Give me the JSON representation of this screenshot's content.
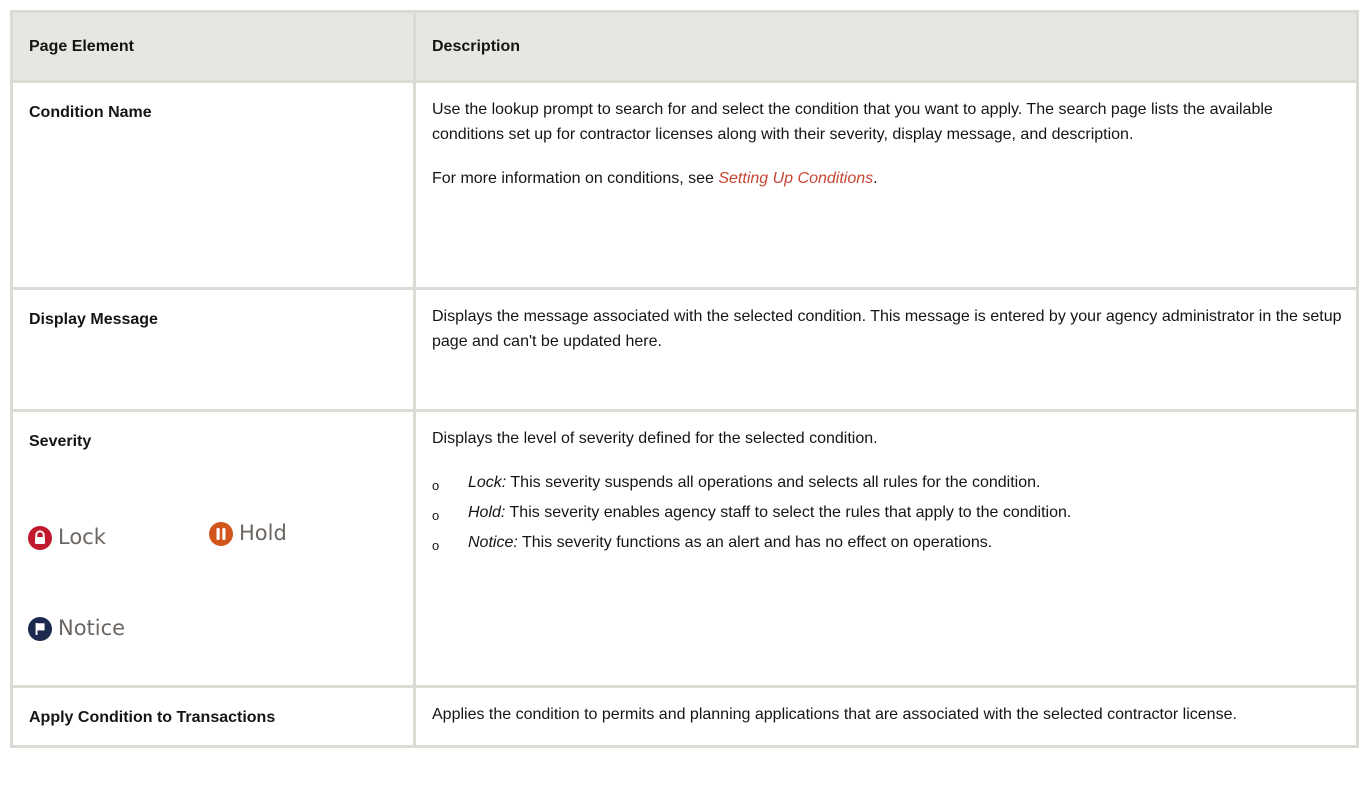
{
  "table": {
    "headers": [
      "Page Element",
      "Description"
    ],
    "rows": [
      {
        "element": "Condition Name",
        "description": [
          "Use the lookup prompt to search for and select the condition that you want to apply. The search page lists the available conditions set up for contractor licenses along with their severity, display message, and description."
        ],
        "more_info_prefix": "For more information on conditions, see ",
        "more_info_link": "Setting Up Conditions",
        "more_info_suffix": "."
      },
      {
        "element": "Display Message",
        "description": [
          "Displays the message associated with the selected condition. This message is entered by your agency administrator in the setup page and can't be updated here."
        ]
      },
      {
        "element": "Severity",
        "description": [
          "Displays the level of severity defined for the selected condition."
        ],
        "severity_icons": [
          {
            "label": "Lock",
            "icon": "lock-icon",
            "color": "#c0182d"
          },
          {
            "label": "Hold",
            "icon": "pause-icon",
            "color": "#d2561b"
          },
          {
            "label": "Notice",
            "icon": "flag-icon",
            "color": "#1b2a4e"
          }
        ],
        "levels": [
          {
            "term": "Lock:",
            "text": " This severity suspends all operations and selects all rules for the condition."
          },
          {
            "term": "Hold:",
            "text": " This severity enables agency staff to select the rules that apply to the condition."
          },
          {
            "term": "Notice:",
            "text": " This severity functions as an alert and has no effect on operations."
          }
        ],
        "bullet": "o"
      },
      {
        "element": "Apply Condition to Transactions",
        "description": [
          "Applies the condition to permits and planning applications that are associated with the selected contractor license."
        ]
      }
    ]
  },
  "colors": {
    "header_bg": "#e8e6e2",
    "border": "#dcdad5",
    "link": "#c74634"
  }
}
